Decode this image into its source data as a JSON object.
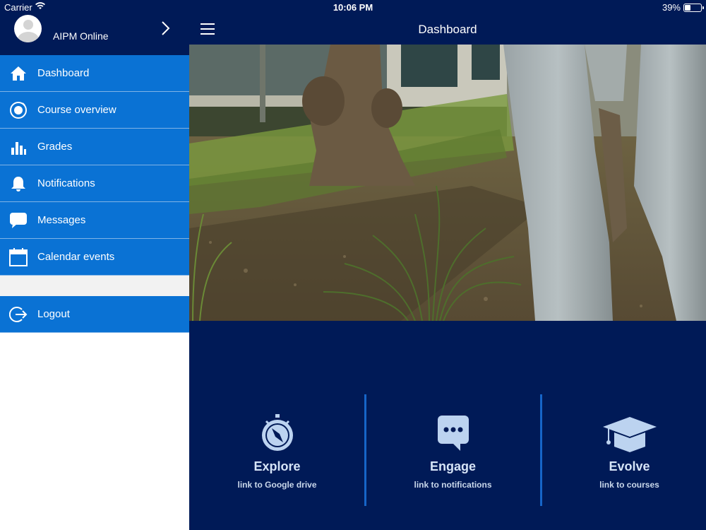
{
  "status": {
    "carrier": "Carrier",
    "time": "10:06 PM",
    "battery": "39%"
  },
  "profile": {
    "name": "AIPM Online"
  },
  "header": {
    "title": "Dashboard"
  },
  "menu": {
    "items": [
      {
        "label": "Dashboard",
        "icon": "home-icon"
      },
      {
        "label": "Course overview",
        "icon": "target-icon"
      },
      {
        "label": "Grades",
        "icon": "bar-chart-icon"
      },
      {
        "label": "Notifications",
        "icon": "bell-icon"
      },
      {
        "label": "Messages",
        "icon": "message-bubble-icon"
      },
      {
        "label": "Calendar events",
        "icon": "calendar-icon"
      }
    ],
    "logout": {
      "label": "Logout",
      "icon": "logout-icon"
    }
  },
  "tiles": [
    {
      "title": "Explore",
      "subtitle": "link to Google drive",
      "icon": "compass-icon"
    },
    {
      "title": "Engage",
      "subtitle": "link to notifications",
      "icon": "chat-icon"
    },
    {
      "title": "Evolve",
      "subtitle": "link to courses",
      "icon": "graduation-cap-icon"
    }
  ],
  "colors": {
    "navy": "#001a57",
    "menu_blue": "#0a72d4",
    "divider_blue": "#1665c8",
    "tile_icon": "#bcd3f0"
  }
}
